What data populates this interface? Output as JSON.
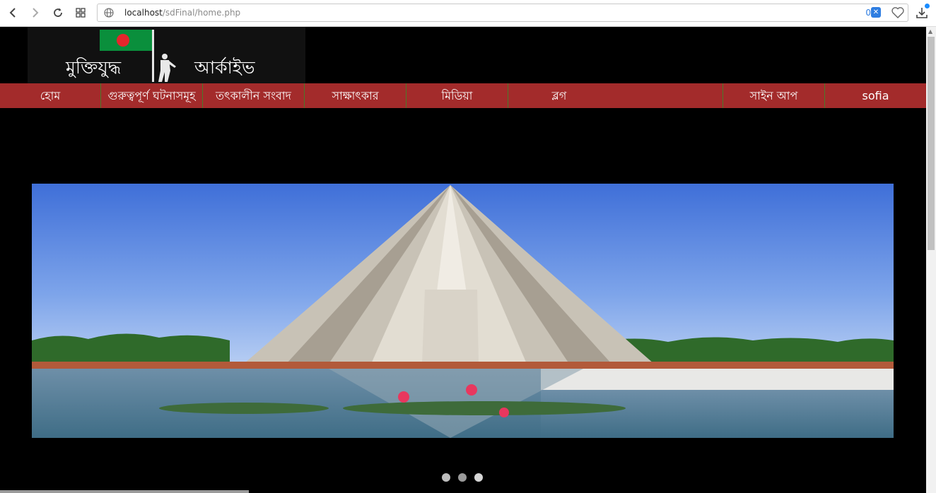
{
  "browser": {
    "url_host": "localhost",
    "url_path": "/sdFinal/home.php",
    "tracker_count": "0",
    "icons": [
      "back-icon",
      "forward-icon",
      "reload-icon",
      "tabs-grid-icon",
      "globe-icon",
      "shield-icon",
      "heart-icon",
      "download-icon"
    ]
  },
  "header": {
    "logo_text_left": "মুক্তিযুদ্ধ",
    "logo_text_right": "আর্কাইভ"
  },
  "menu": {
    "items": [
      {
        "label": "হোম"
      },
      {
        "label": "গুরুত্বপূর্ণ ঘটনাসমূহ"
      },
      {
        "label": "তৎকালীন সংবাদ"
      },
      {
        "label": "সাক্ষাৎকার"
      },
      {
        "label": "মিডিয়া"
      },
      {
        "label": "ব্লগ"
      },
      {
        "label": ""
      },
      {
        "label": "সাইন আপ"
      },
      {
        "label": "sofia"
      }
    ]
  },
  "carousel": {
    "slide_count": 3,
    "active_index": 0
  },
  "colors": {
    "menu_bg": "#a32b2b",
    "page_bg": "#000000",
    "flag_green": "#0a8f3c",
    "flag_red": "#e6262c"
  }
}
